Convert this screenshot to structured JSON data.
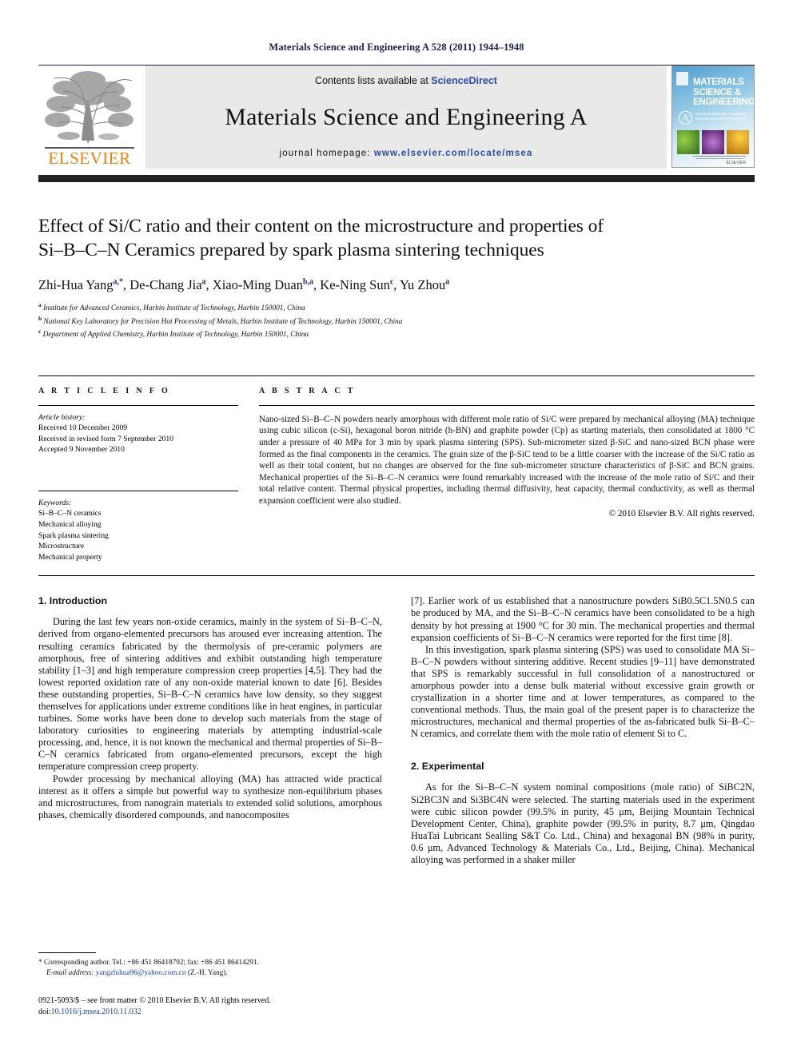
{
  "running_head": "Materials Science and Engineering A 528 (2011) 1944–1948",
  "masthead": {
    "contents_prefix": "Contents lists available at ",
    "sciencedirect": "ScienceDirect",
    "journal_title": "Materials Science and Engineering A",
    "homepage_prefix": "journal homepage: ",
    "homepage_url": "www.elsevier.com/locate/msea",
    "publisher_wordmark": "ELSEVIER",
    "publisher_color": "#E8820C",
    "cover": {
      "title_line1": "MATERIALS",
      "title_line2": "SCIENCE &",
      "title_line3": "ENGINEERING",
      "badge": "A",
      "subtitle": "Structural Materials: Properties, Microstructure and Processing",
      "brand": "ELSEVIER"
    }
  },
  "article": {
    "title_line1": "Effect of Si/C ratio and their content on the microstructure and properties of",
    "title_line2": "Si–B–C–N Ceramics prepared by spark plasma sintering techniques",
    "authors": [
      {
        "name": "Zhi-Hua Yang",
        "sup": "a,*"
      },
      {
        "name": "De-Chang Jia",
        "sup": "a"
      },
      {
        "name": "Xiao-Ming Duan",
        "sup": "b,a"
      },
      {
        "name": "Ke-Ning Sun",
        "sup": "c"
      },
      {
        "name": "Yu Zhou",
        "sup": "a"
      }
    ],
    "affiliations": [
      {
        "mark": "a",
        "text": "Institute for Advanced Ceramics, Harbin Institute of Technology, Harbin 150001, China"
      },
      {
        "mark": "b",
        "text": "National Key Laboratory for Precision Hot Processing of Metals, Harbin Institute of Technology, Harbin 150001, China"
      },
      {
        "mark": "c",
        "text": "Department of Applied Chemistry, Harbin Institute of Technology, Harbin 150001, China"
      }
    ]
  },
  "article_info": {
    "label": "A R T I C L E  I N F O",
    "history_title": "Article history:",
    "history": [
      "Received 10 December 2009",
      "Received in revised form 7 September 2010",
      "Accepted 9 November 2010"
    ],
    "keywords_title": "Keywords:",
    "keywords": [
      "Si–B–C–N ceramics",
      "Mechanical alloying",
      "Spark plasma sintering",
      "Microstructure",
      "Mechanical property"
    ]
  },
  "abstract": {
    "label": "A B S T R A C T",
    "text": "Nano-sized Si–B–C–N powders nearly amorphous with different mole ratio of Si/C were prepared by mechanical alloying (MA) technique using cubic silicon (c-Si), hexagonal boron nitride (h-BN) and graphite powder (Cp) as starting materials, then consolidated at 1800 °C under a pressure of 40 MPa for 3 min by spark plasma sintering (SPS). Sub-micrometer sized β-SiC and nano-sized BCN phase were formed as the final components in the ceramics. The grain size of the β-SiC tend to be a little coarser with the increase of the Si/C ratio as well as their total content, but no changes are observed for the fine sub-micrometer structure characteristics of β-SiC and BCN grains. Mechanical properties of the Si–B–C–N ceramics were found remarkably increased with the increase of the mole ratio of Si/C and their total relative content. Thermal physical properties, including thermal diffusivity, heat capacity, thermal conductivity, as well as thermal expansion coefficient were also studied.",
    "copyright": "© 2010 Elsevier B.V. All rights reserved."
  },
  "sections": {
    "intro_heading": "1.  Introduction",
    "intro_p1": "During the last few years non-oxide ceramics, mainly in the system of Si–B–C–N, derived from organo-elemented precursors has aroused ever increasing attention. The resulting ceramics fabricated by the thermolysis of pre-ceramic polymers are amorphous, free of sintering additives and exhibit outstanding high temperature stability [1–3] and high temperature compression creep properties [4,5]. They had the lowest reported oxidation rate of any non-oxide material known to date [6]. Besides these outstanding properties, Si–B–C–N ceramics have low density, so they suggest themselves for applications under extreme conditions like in heat engines, in particular turbines. Some works have been done to develop such materials from the stage of laboratory curiosities to engineering materials by attempting industrial-scale processing, and, hence, it is not known the mechanical and thermal properties of Si–B–C–N ceramics fabricated from organo-elemented precursors, except the high temperature compression creep property.",
    "intro_p2": "Powder processing by mechanical alloying (MA) has attracted wide practical interest as it offers a simple but powerful way to synthesize non-equilibrium phases and microstructures, from nanograin materials to extended solid solutions, amorphous phases, chemically disordered compounds, and nanocomposites",
    "intro_p3": "[7]. Earlier work of us established that a nanostructure powders SiB0.5C1.5N0.5 can be produced by MA, and the Si–B–C–N ceramics have been consolidated to be a high density by hot pressing at 1900 °C for 30 min. The mechanical properties and thermal expansion coefficients of Si–B–C–N ceramics were reported for the first time [8].",
    "intro_p4": "In this investigation, spark plasma sintering (SPS) was used to consolidate MA Si–B–C–N powders without sintering additive. Recent studies [9–11] have demonstrated that SPS is remarkably successful in full consolidation of a nanostructured or amorphous powder into a dense bulk material without excessive grain growth or crystallization in a shorter time and at lower temperatures, as compared to the conventional methods. Thus, the main goal of the present paper is to characterize the microstructures, mechanical and thermal properties of the as-fabricated bulk Si–B–C–N ceramics, and correlate them with the mole ratio of element Si to C.",
    "exp_heading": "2.  Experimental",
    "exp_p1": "As for the Si–B–C–N system nominal compositions (mole ratio) of SiBC2N, Si2BC3N and Si3BC4N were selected. The starting materials used in the experiment were cubic silicon powder (99.5% in purity, 45 μm, Beijing Mountain Technical Development Center, China), graphite powder (99.5% in purity, 8.7 μm, Qingdao HuaTai Lubricant Sealling S&T Co. Ltd., China) and hexagonal BN (98% in purity, 0.6 μm, Advanced Technology & Materials Co., Ltd., Beijing, China). Mechanical alloying was performed in a shaker miller"
  },
  "footnote": {
    "corresponding": "* Corresponding author. Tel.: +86 451 86418792; fax: +86 451 86414291.",
    "email_label": "E-mail address:",
    "email": "yangzhihua96@yahoo.com.cn",
    "email_owner": "(Z.-H. Yang).",
    "issn_line": "0921-5093/$ – see front matter © 2010 Elsevier B.V. All rights reserved.",
    "doi_label": "doi:",
    "doi": "10.1016/j.msea.2010.11.032"
  }
}
